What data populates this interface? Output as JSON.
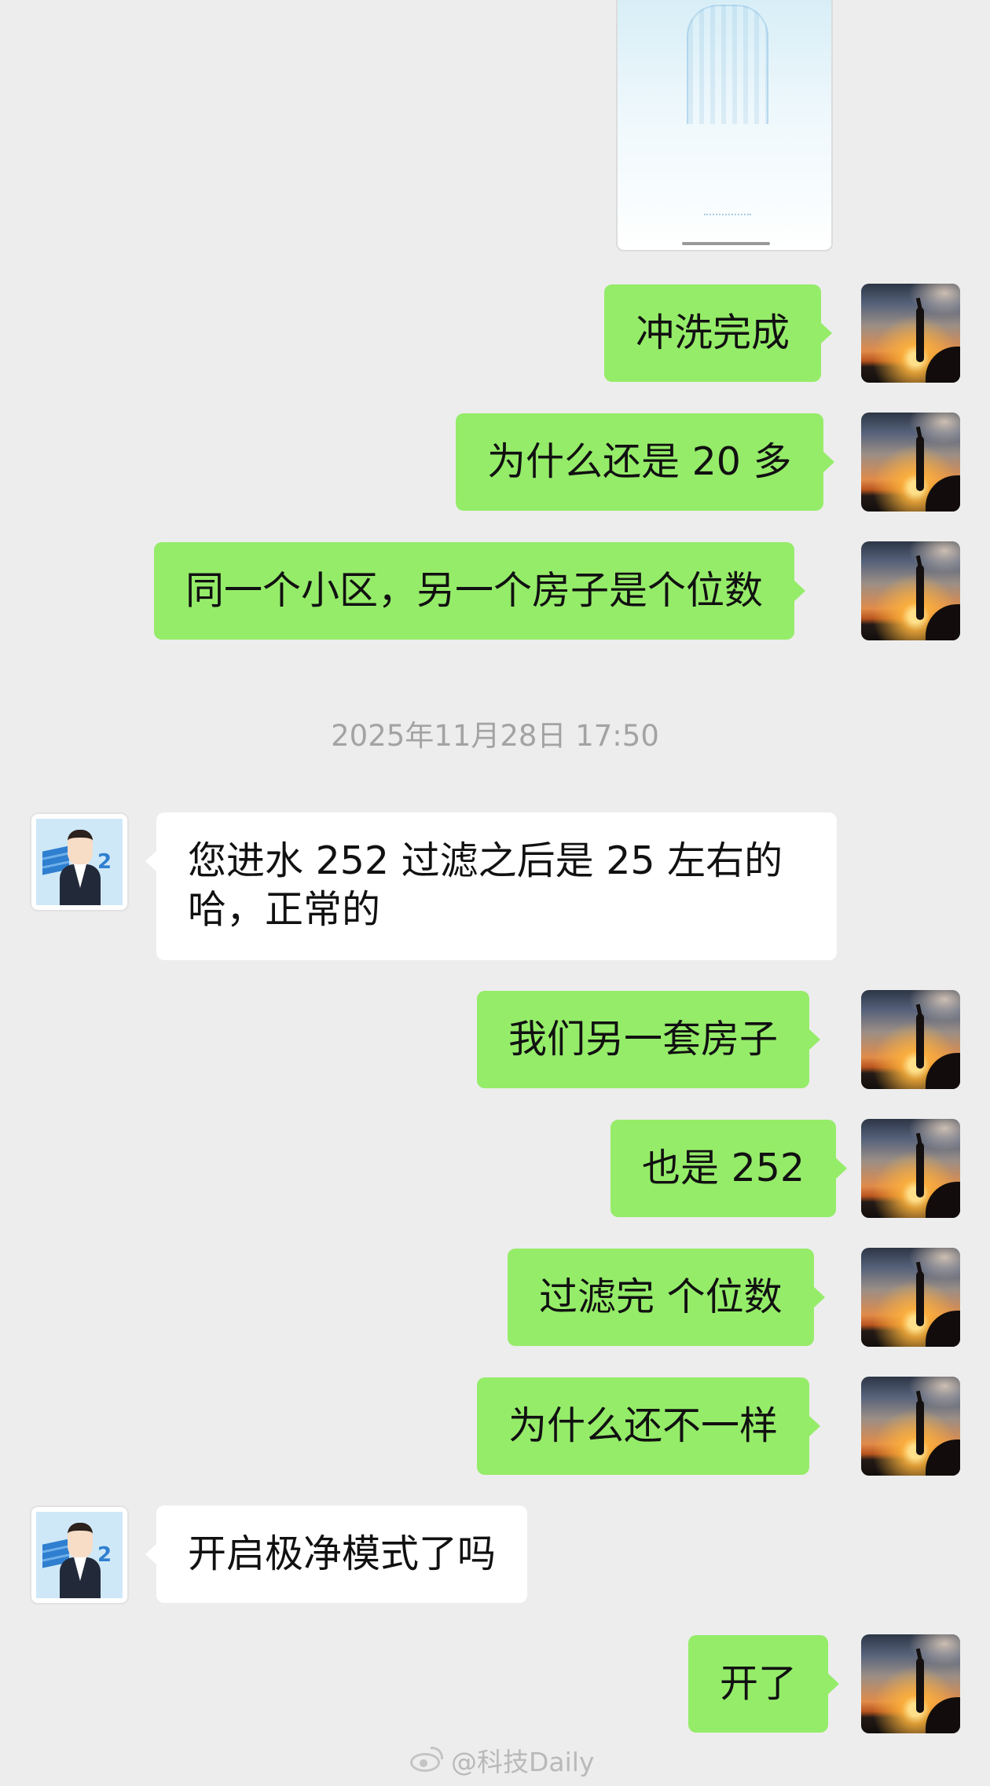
{
  "chat": {
    "top_image": {
      "type": "image-message"
    },
    "timestamp": "2025年11月28日 17:50",
    "messages": [
      {
        "side": "self",
        "text": "冲洗完成"
      },
      {
        "side": "self",
        "text": "为什么还是 20 多"
      },
      {
        "side": "self",
        "text": "同一个小区，另一个房子是个位数"
      },
      {
        "side": "other",
        "text": "您进水 252 过滤之后是 25 左右的哈，正常的"
      },
      {
        "side": "self",
        "text": "我们另一套房子"
      },
      {
        "side": "self",
        "text": "也是 252"
      },
      {
        "side": "self",
        "text": "过滤完 个位数"
      },
      {
        "side": "self",
        "text": "为什么还不一样"
      },
      {
        "side": "other",
        "text": "开启极净模式了吗"
      },
      {
        "side": "self",
        "text": "开了"
      }
    ]
  },
  "watermark": {
    "text": "@科技Daily",
    "icon": "weibo-icon"
  },
  "colors": {
    "background": "#ededed",
    "self_bubble": "#95ec69",
    "other_bubble": "#ffffff",
    "timestamp": "#a3a3a3"
  }
}
